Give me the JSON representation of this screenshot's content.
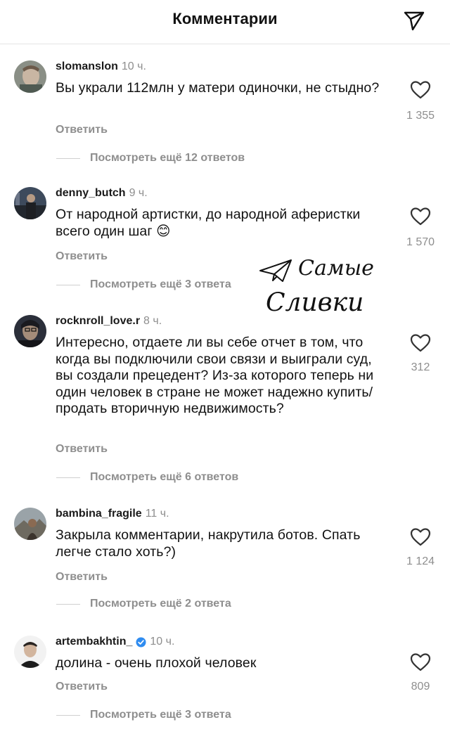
{
  "header": {
    "title": "Комментарии",
    "share_icon": "send-icon"
  },
  "comments": [
    {
      "username": "slomanslon",
      "time": "10 ч.",
      "text": "Вы украли 112млн у матери одиночки, не стыдно?",
      "reply_label": "Ответить",
      "likes": "1 355",
      "view_more": "Посмотреть ещё 12 ответов",
      "verified": false
    },
    {
      "username": "denny_butch",
      "time": "9 ч.",
      "text": "От народной артистки, до народной аферистки всего один шаг 😊",
      "reply_label": "Ответить",
      "likes": "1 570",
      "view_more": "Посмотреть ещё 3 ответа",
      "verified": false
    },
    {
      "username": "rocknroll_love.r",
      "time": "8 ч.",
      "text": "Интересно, отдаете ли вы себе отчет в том, что когда вы подключили свои связи и выиграли суд, вы создали прецедент? Из-за которого теперь ни один человек в стране не может надежно купить/продать  вторичную недвижимость?",
      "reply_label": "Ответить",
      "likes": "312",
      "view_more": "Посмотреть ещё 6 ответов",
      "verified": false
    },
    {
      "username": "bambina_fragile",
      "time": "11 ч.",
      "text": "Закрыла комментарии, накрутила ботов. Спать легче стало хоть?)",
      "reply_label": "Ответить",
      "likes": "1 124",
      "view_more": "Посмотреть ещё 2 ответа",
      "verified": false
    },
    {
      "username": "artembakhtin_",
      "time": "10 ч.",
      "text": "долина - очень плохой человек",
      "reply_label": "Ответить",
      "likes": "809",
      "view_more": "Посмотреть ещё 3 ответа",
      "verified": true
    }
  ],
  "watermark": {
    "line1": "Самые",
    "line2": "Сливки"
  },
  "colors": {
    "text": "#111111",
    "secondary": "#8e8e8e",
    "verified": "#2f8cf0",
    "divider": "#e4e4e4"
  }
}
